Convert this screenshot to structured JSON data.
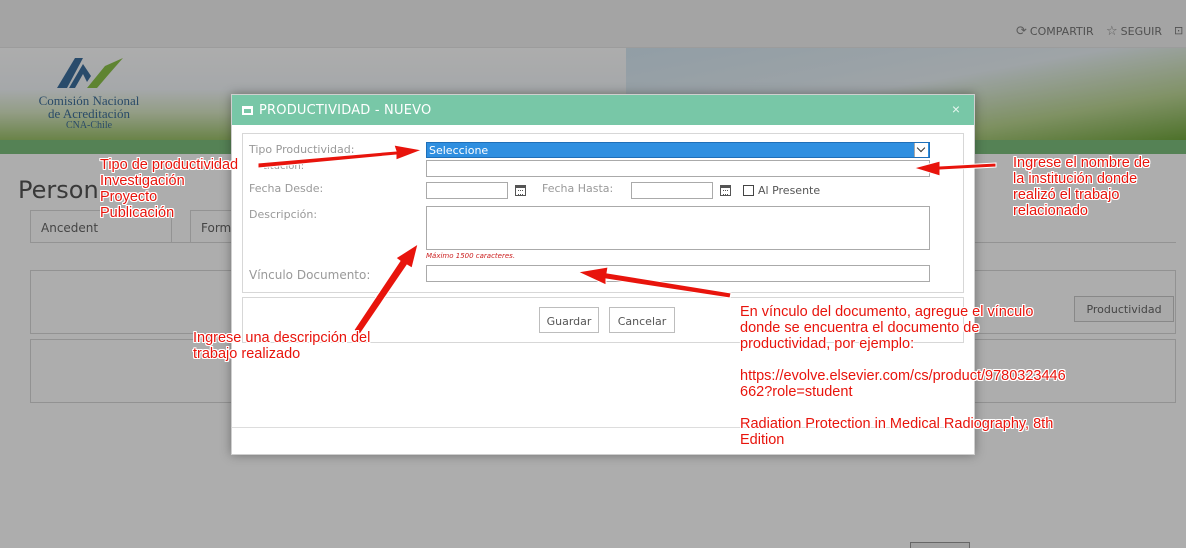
{
  "header": {
    "share_label": "COMPARTIR",
    "follow_label": "SEGUIR"
  },
  "logo": {
    "line1": "Comisión Nacional",
    "line2": "de Acreditación",
    "line3": "CNA-Chile"
  },
  "page": {
    "title": "Person",
    "tabs": [
      "Ancedent",
      "Form"
    ],
    "add_productivity_label": "Productividad"
  },
  "modal": {
    "title": "PRODUCTIVIDAD - NUEVO",
    "close": "×",
    "fields": {
      "tipo_label": "Tipo Productividad:",
      "tipo_value": "Seleccione",
      "institucion_label": "titución:",
      "fecha_desde_label": "Fecha Desde:",
      "fecha_hasta_label": "Fecha Hasta:",
      "al_presente_label": "Al Presente",
      "descripcion_label": "Descripción:",
      "descripcion_hint": "Máximo 1500 caracteres.",
      "vinculo_label": "Vínculo Documento:"
    },
    "buttons": {
      "save": "Guardar",
      "cancel": "Cancelar"
    }
  },
  "annotations": {
    "tipo": [
      "Tipo de productividad",
      "Investigación",
      "Proyecto",
      "Publicación"
    ],
    "institucion": [
      "Ingrese el nombre de",
      "la institución donde",
      "realizó el trabajo",
      "relacionado"
    ],
    "descripcion": [
      "Ingrese una descripción del",
      "trabajo realizado"
    ],
    "vinculo": [
      "En vínculo del documento, agregue el vínculo",
      "donde se encuentra el documento de",
      "productividad, por ejemplo:",
      "",
      "https://evolve.elsevier.com/cs/product/9780323446",
      "662?role=student",
      "",
      "Radiation Protection in Medical Radiography, 8th",
      "Edition"
    ]
  },
  "colors": {
    "modal_header": "#78c7a7",
    "select_highlight": "#2f8fe0",
    "annotation_red": "#e8140c"
  }
}
